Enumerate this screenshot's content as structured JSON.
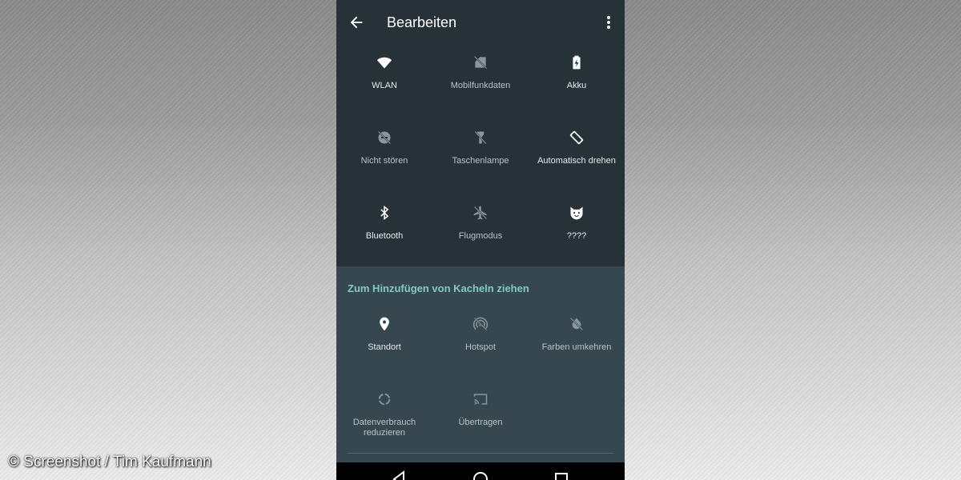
{
  "toolbar": {
    "title": "Bearbeiten",
    "back_icon": "arrow-left-icon",
    "menu_icon": "more-vert-icon"
  },
  "active_tiles": [
    {
      "label": "WLAN",
      "icon": "wifi-icon",
      "enabled": true
    },
    {
      "label": "Mobilfunkdaten",
      "icon": "mobile-data-off-icon",
      "enabled": false
    },
    {
      "label": "Akku",
      "icon": "battery-charging-icon",
      "enabled": true
    },
    {
      "label": "Nicht stören",
      "icon": "do-not-disturb-icon",
      "enabled": false
    },
    {
      "label": "Taschenlampe",
      "icon": "flashlight-icon",
      "enabled": false
    },
    {
      "label": "Automatisch drehen",
      "icon": "auto-rotate-icon",
      "enabled": true
    },
    {
      "label": "Bluetooth",
      "icon": "bluetooth-icon",
      "enabled": true
    },
    {
      "label": "Flugmodus",
      "icon": "airplane-mode-icon",
      "enabled": false
    },
    {
      "label": "????",
      "icon": "cat-icon",
      "enabled": true
    }
  ],
  "add_section": {
    "header": "Zum Hinzufügen von Kacheln ziehen",
    "tiles": [
      {
        "label": "Standort",
        "icon": "location-icon",
        "enabled": true
      },
      {
        "label": "Hotspot",
        "icon": "hotspot-icon",
        "enabled": false
      },
      {
        "label": "Farben umkehren",
        "icon": "invert-colors-icon",
        "enabled": false
      },
      {
        "label": "Datenverbrauch reduzieren",
        "icon": "data-saver-icon",
        "enabled": false
      },
      {
        "label": "Übertragen",
        "icon": "cast-icon",
        "enabled": false
      }
    ]
  },
  "navbar": {
    "back_icon": "nav-back-icon",
    "home_icon": "nav-home-icon",
    "recents_icon": "nav-recents-icon"
  },
  "credit": "© Screenshot / Tim Kaufmann",
  "colors": {
    "panel": "#263238",
    "add_area": "#37474f",
    "accent": "#80cbc4",
    "icon_on": "#ffffff",
    "icon_off": "#8a979d"
  }
}
